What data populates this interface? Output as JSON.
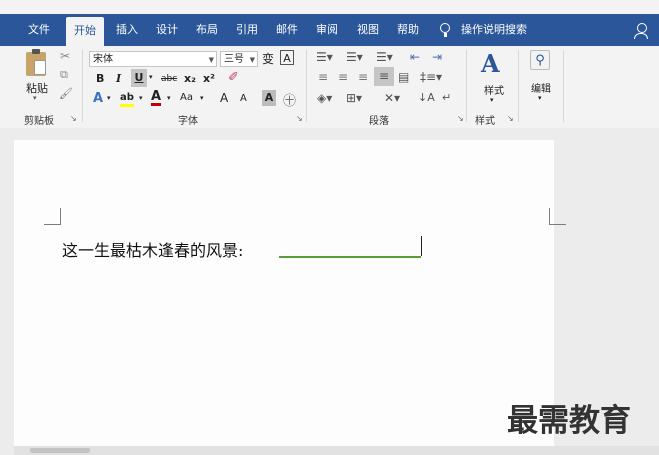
{
  "menu": {
    "tabs": [
      "文件",
      "开始",
      "插入",
      "设计",
      "布局",
      "引用",
      "邮件",
      "审阅",
      "视图",
      "帮助"
    ],
    "active_tab": "开始",
    "tell_me": "操作说明搜索"
  },
  "ribbon": {
    "clipboard": {
      "paste": "粘贴",
      "group_label": "剪贴板"
    },
    "font": {
      "font_name": "宋体",
      "font_size": "三号",
      "wen_glyph": "变",
      "a_box": "A",
      "bold": "B",
      "italic": "I",
      "underline": "U",
      "strike": "abc",
      "subscript": "x₂",
      "superscript": "x²",
      "text_effect": "A",
      "highlight": "ab",
      "font_color": "A",
      "change_case": "Aa",
      "grow": "A",
      "shrink": "A",
      "char_shade": "A",
      "enclose": "㊉",
      "group_label": "字体"
    },
    "paragraph": {
      "group_label": "段落"
    },
    "styles": {
      "label": "样式",
      "group_label": "样式"
    },
    "editing": {
      "label": "编辑"
    }
  },
  "document": {
    "text": "这一生最枯木逢春的风景:"
  },
  "watermark": "最需教育",
  "colors": {
    "menu_bg": "#2b579a",
    "underline_green": "#5a9e3c",
    "font_color_red": "#c00000",
    "highlight_yellow": "#ffff00"
  }
}
